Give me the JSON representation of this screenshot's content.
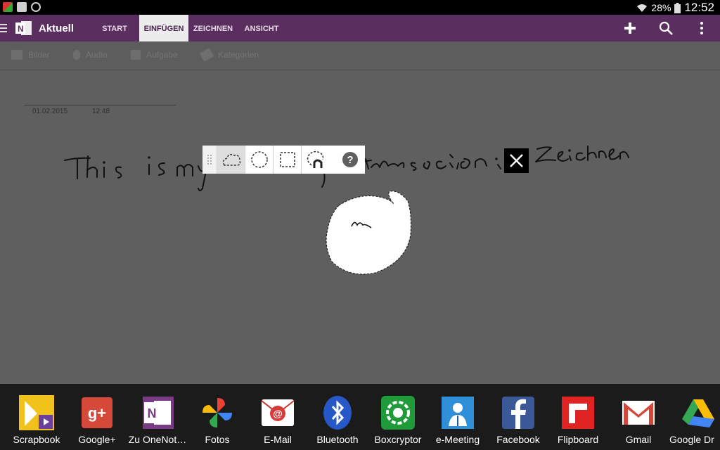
{
  "status": {
    "battery": "28%",
    "time": "12:52"
  },
  "appbar": {
    "title": "Aktuell",
    "tabs": [
      {
        "label": "START"
      },
      {
        "label": "EINFÜGEN",
        "active": true
      },
      {
        "label": "ZEICHNEN"
      },
      {
        "label": "ANSICHT"
      }
    ]
  },
  "ribbon": {
    "items": [
      {
        "label": "Bilder",
        "icon": "camera-icon"
      },
      {
        "label": "Audio",
        "icon": "microphone-icon"
      },
      {
        "label": "Aufgabe",
        "icon": "checkbox-icon"
      },
      {
        "label": "Kategorien",
        "icon": "tag-icon"
      }
    ]
  },
  "page": {
    "date": "01.02.2015",
    "time": "12:48",
    "handwriting": [
      "This is my",
      "the section in Zeichnen"
    ]
  },
  "lasso_toolbar": {
    "tools": [
      "freeform-lasso-icon",
      "circle-select-icon",
      "rectangle-select-icon",
      "magnet-lasso-icon"
    ],
    "help": "?"
  },
  "dock": {
    "apps": [
      {
        "label": "Scrapbook",
        "color": "#f1c21b"
      },
      {
        "label": "Google+",
        "color": "#d5493a"
      },
      {
        "label": "Zu OneNot…",
        "color": "#7a3b86"
      },
      {
        "label": "Fotos",
        "color": "#ffffff"
      },
      {
        "label": "E-Mail",
        "color": "#ffffff"
      },
      {
        "label": "Bluetooth",
        "color": "#2758c7"
      },
      {
        "label": "Boxcryptor",
        "color": "#1f9b3a"
      },
      {
        "label": "e-Meeting",
        "color": "#2f8fd8"
      },
      {
        "label": "Facebook",
        "color": "#3b5998"
      },
      {
        "label": "Flipboard",
        "color": "#e02424"
      },
      {
        "label": "Gmail",
        "color": "#ffffff"
      },
      {
        "label": "Google Dr",
        "color": "#ffffff"
      }
    ]
  }
}
